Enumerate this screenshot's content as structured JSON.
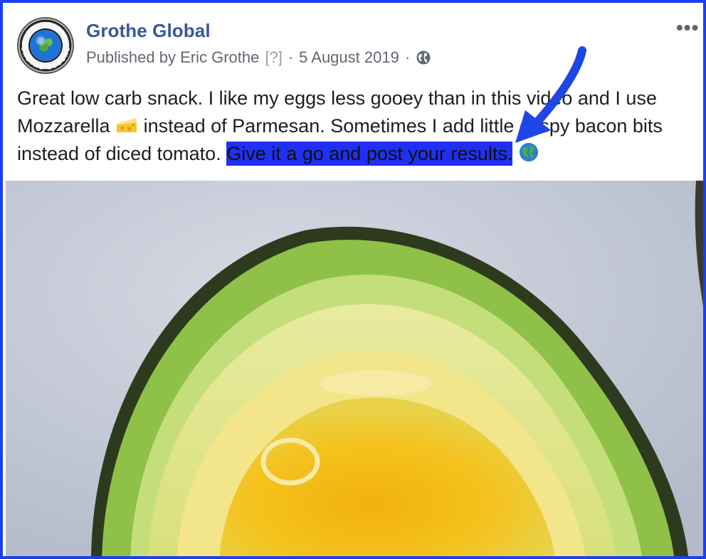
{
  "post": {
    "page_name": "Grothe Global",
    "published_by": "Published by Eric Grothe",
    "help_marker": "[?]",
    "date": "5 August 2019",
    "separator": "·",
    "privacy_icon": "globe-icon",
    "more_icon": "more-options-icon",
    "more_glyph": "•••",
    "text_part1": "Great low carb snack. I like my eggs less gooey than in this video and I use Mozzarella",
    "text_part2": "instead of Parmesan. Sometimes I add little crispy bacon bits instead of diced tomato.",
    "text_highlight": "Give it a go and post your results.",
    "emoji_cheese": "cheese-emoji",
    "emoji_globe": "globe-emoji"
  },
  "avatar": {
    "ring_text_top": "GROTHE GLOBAL",
    "ring_text_bottom": "GROTHE GLOBAL"
  },
  "colors": {
    "frame_border": "#1b3ff0",
    "page_name": "#385898",
    "highlight": "#1f2ff5",
    "arrow": "#1e46e6"
  }
}
